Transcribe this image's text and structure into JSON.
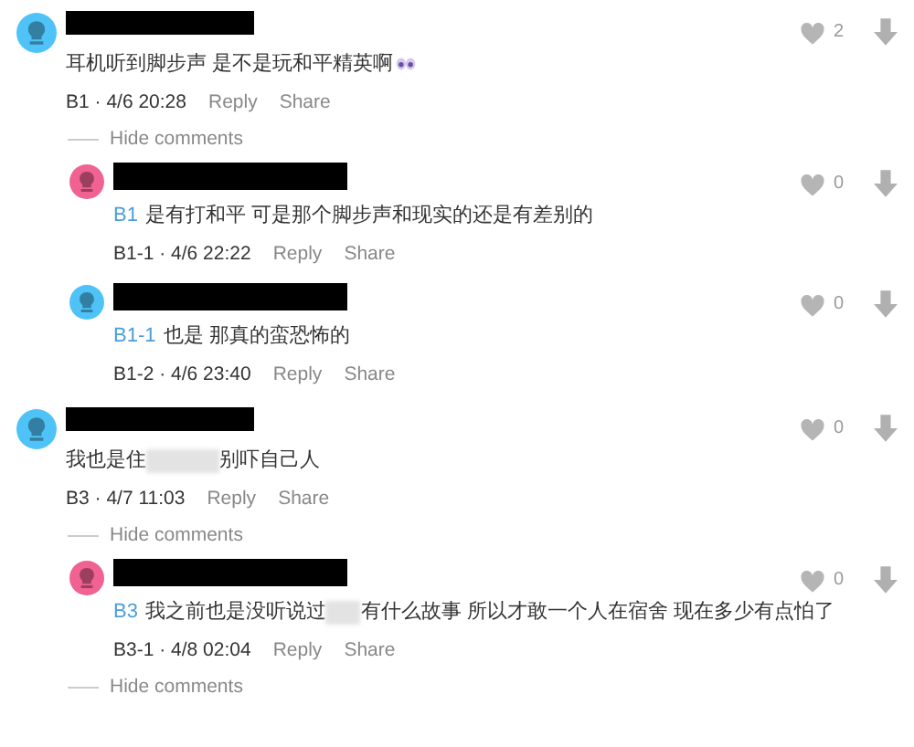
{
  "items": [
    {
      "kind": "comment",
      "color": "#4fc3f7",
      "likes": "2",
      "body": [
        {
          "kind": "text",
          "text": "耳机听到脚步声 是不是玩和平精英啊"
        },
        {
          "kind": "emoji"
        }
      ],
      "floor": "B1",
      "sep": "·",
      "date": "4/6 20:28",
      "actions": [
        "Reply",
        "Share"
      ],
      "children": [
        {
          "kind": "hide",
          "text": "Hide comments"
        },
        {
          "kind": "comment",
          "color": "#f06292",
          "likes": "0",
          "body": [
            {
              "kind": "mention",
              "text": "B1"
            },
            {
              "kind": "text",
              "text": "是有打和平 可是那个脚步声和现实的还是有差别的"
            }
          ],
          "floor": "B1-1",
          "sep": "·",
          "date": "4/6 22:22",
          "actions": [
            "Reply",
            "Share"
          ]
        },
        {
          "kind": "comment",
          "color": "#4fc3f7",
          "likes": "0",
          "body": [
            {
              "kind": "mention",
              "text": "B1-1"
            },
            {
              "kind": "text",
              "text": "也是 那真的蛮恐怖的"
            }
          ],
          "floor": "B1-2",
          "sep": "·",
          "date": "4/6 23:40",
          "actions": [
            "Reply",
            "Share"
          ]
        }
      ]
    },
    {
      "kind": "comment",
      "color": "#4fc3f7",
      "likes": "0",
      "body": [
        {
          "kind": "text",
          "text": "我也是住"
        },
        {
          "kind": "blur-wide"
        },
        {
          "kind": "text",
          "text": "别吓自己人"
        }
      ],
      "floor": "B3",
      "sep": "·",
      "date": "4/7 11:03",
      "actions": [
        "Reply",
        "Share"
      ],
      "children": [
        {
          "kind": "hide",
          "text": "Hide comments"
        },
        {
          "kind": "comment",
          "color": "#f06292",
          "likes": "0",
          "body": [
            {
              "kind": "mention",
              "text": "B3"
            },
            {
              "kind": "text",
              "text": "我之前也是没听说过"
            },
            {
              "kind": "blur-narrow"
            },
            {
              "kind": "text",
              "text": "有什么故事 所以才敢一个人在宿舍 现在多少有点怕了"
            }
          ],
          "floor": "B3-1",
          "sep": "·",
          "date": "4/8 02:04",
          "actions": [
            "Reply",
            "Share"
          ]
        },
        {
          "kind": "hide",
          "text": "Hide comments"
        }
      ]
    }
  ]
}
